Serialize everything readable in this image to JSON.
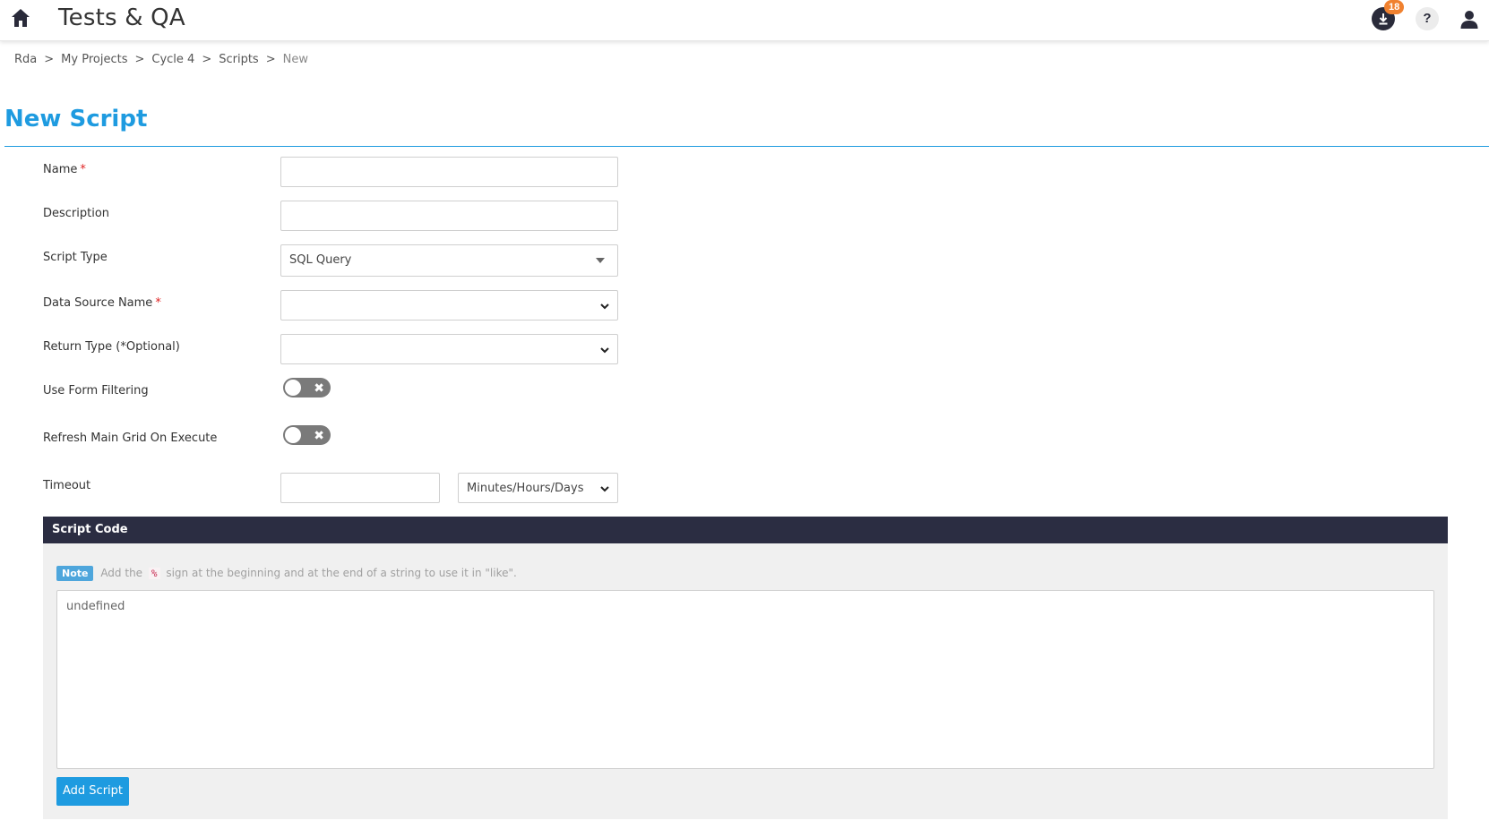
{
  "app": {
    "title": "Tests & QA",
    "notifications_count": "18",
    "help_label": "?"
  },
  "breadcrumb": [
    {
      "label": "Rda"
    },
    {
      "label": "My Projects"
    },
    {
      "label": "Cycle 4"
    },
    {
      "label": "Scripts"
    },
    {
      "label": "New"
    }
  ],
  "breadcrumb_sep": ">",
  "page": {
    "title": "New Script"
  },
  "form": {
    "name_label": "Name",
    "description_label": "Description",
    "script_type_label": "Script Type",
    "script_type_value": "SQL Query",
    "data_source_label": "Data Source Name",
    "return_type_label": "Return Type (*Optional)",
    "form_filtering_label": "Use Form Filtering",
    "refresh_grid_label": "Refresh Main Grid On Execute",
    "timeout_label": "Timeout",
    "timeout_unit_value": "Minutes/Hours/Days",
    "required_mark": "*",
    "toggle_off_mark": "✖"
  },
  "script_code": {
    "header": "Script Code",
    "note_badge": "Note",
    "note_before": "Add the",
    "note_symbol": "%",
    "note_after": "sign at the beginning and at the end of a string to use it in \"like\".",
    "code_value": "undefined",
    "add_button_label": "Add Script"
  },
  "colors": {
    "accent": "#1e9be0",
    "header_dark": "#2b2d42",
    "badge_orange": "#f0812f",
    "required_red": "#e02424"
  }
}
